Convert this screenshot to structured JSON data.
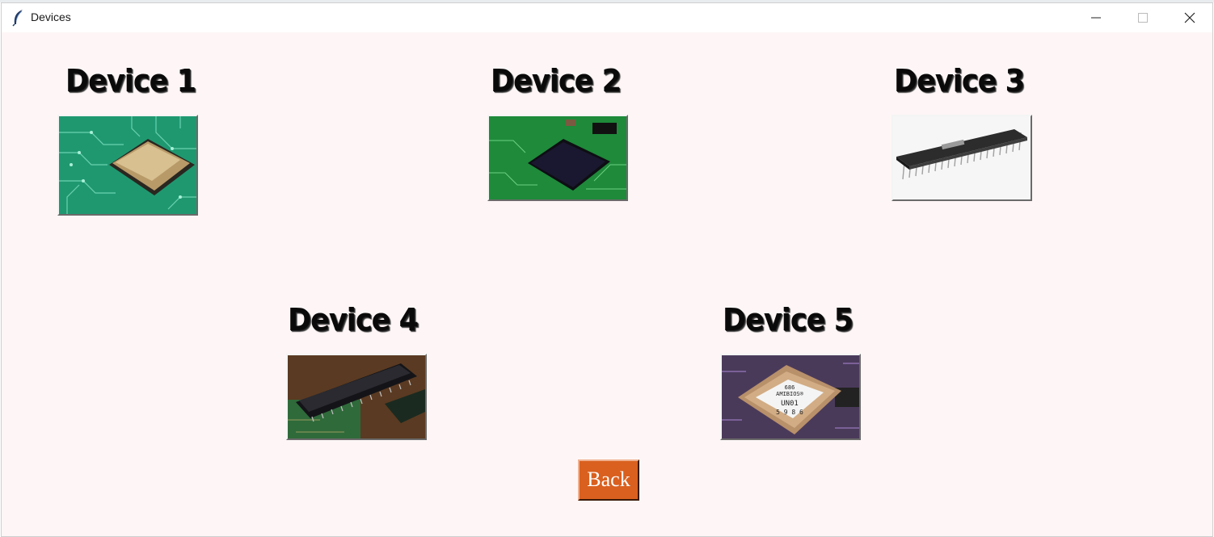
{
  "window": {
    "title": "Devices"
  },
  "devices": [
    {
      "label": "Device 1"
    },
    {
      "label": "Device 2"
    },
    {
      "label": "Device 3"
    },
    {
      "label": "Device 4"
    },
    {
      "label": "Device 5"
    }
  ],
  "chip5_text": {
    "line1": "686",
    "line2": "AMIBIOS®",
    "line3": "UN01",
    "line4": "5 9 8 6"
  },
  "back_label": "Back",
  "colors": {
    "back_button": "#d9601f",
    "background": "#fef6f6"
  }
}
